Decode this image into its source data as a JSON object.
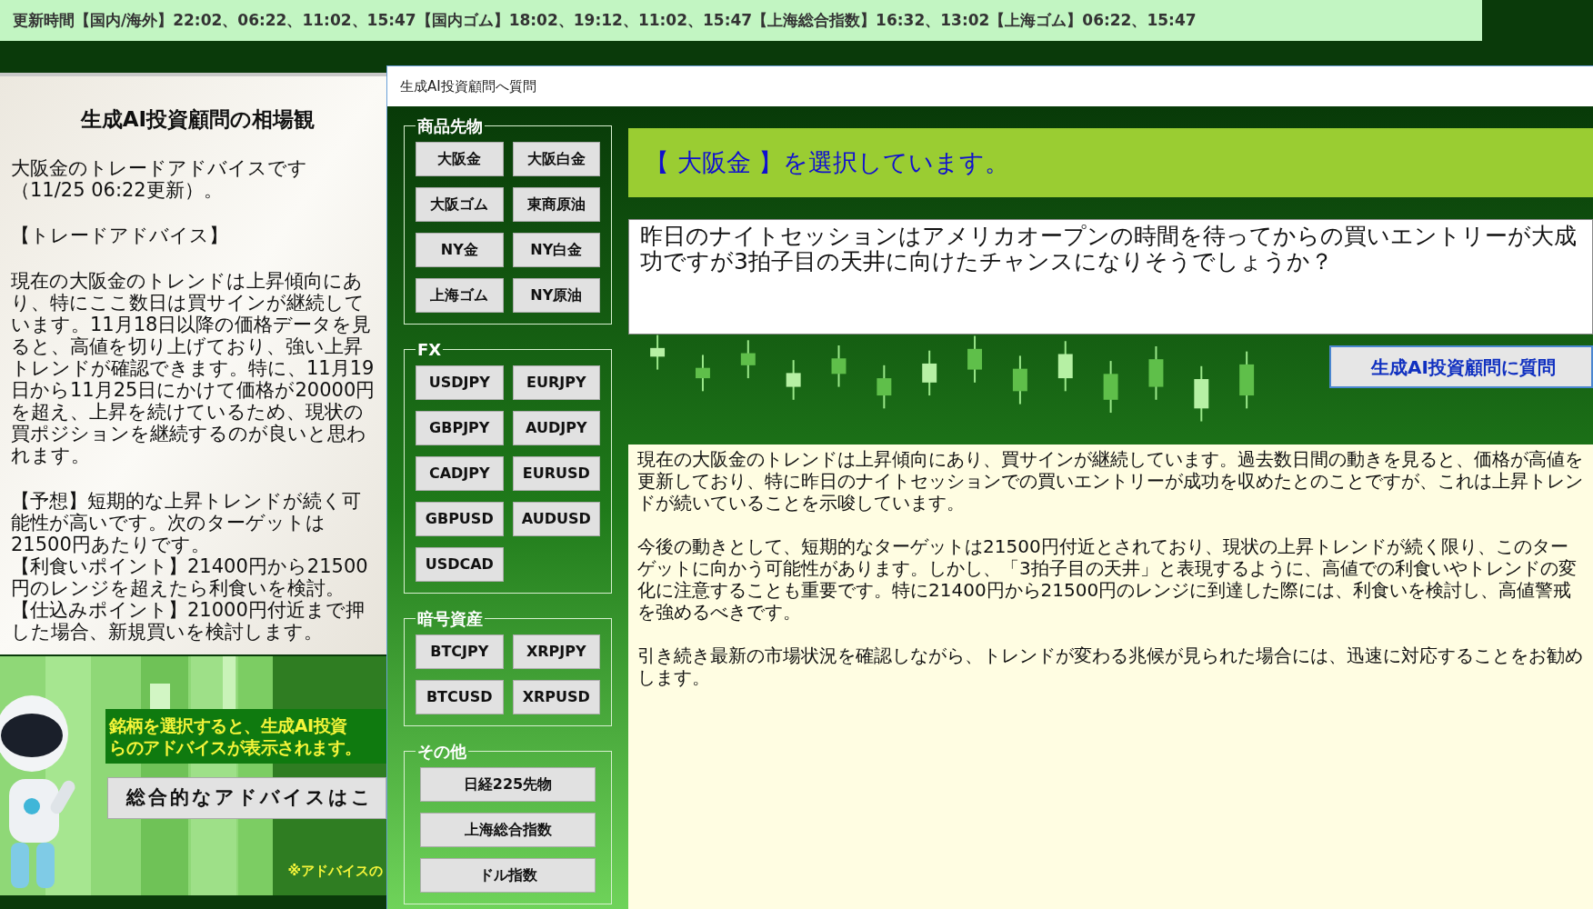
{
  "update_bar": {
    "text": "更新時間【国内/海外】22:02、06:22、11:02、15:47【国内ゴム】18:02、19:12、11:02、15:47【上海総合指数】16:32、13:02【上海ゴム】06:22、15:47"
  },
  "advice_panel": {
    "title": "生成AI投資顧問の相場観",
    "blocks": [
      [
        "大阪金のトレードアドバイスです（11/25 06:22更新）。"
      ],
      [
        "【トレードアドバイス】"
      ],
      [
        "現在の大阪金のトレンドは上昇傾向にあり、特にここ数日は買サインが継続しています。11月18日以降の価格データを見ると、高値を切り上げており、強い上昇トレンドが確認できます。特に、11月19日から11月25日にかけて価格が20000円を超え、上昇を続けているため、現状の買ポジションを継続するのが良いと思われます。"
      ],
      [
        "【予想】短期的な上昇トレンドが続く可能性が高いです。次のターゲットは21500円あたりです。",
        "【利食いポイント】21400円から21500円のレンジを超えたら利食いを検討。",
        "【仕込みポイント】21000円付近まで押した場合、新規買いを検討します。"
      ]
    ]
  },
  "banner": {
    "message_lines": [
      "銘柄を選択すると、生成AI投資",
      "らのアドバイスが表示されます。"
    ],
    "button": "総合的なアドバイスはこ",
    "note": "※アドバイスの"
  },
  "dialog": {
    "title": "生成AI投資顧問へ質問",
    "groups": [
      {
        "label": "商品先物",
        "kind": "grid",
        "buttons": [
          "大阪金",
          "大阪白金",
          "大阪ゴム",
          "東商原油",
          "NY金",
          "NY白金",
          "上海ゴム",
          "NY原油"
        ]
      },
      {
        "label": "FX",
        "kind": "grid",
        "buttons": [
          "USDJPY",
          "EURJPY",
          "GBPJPY",
          "AUDJPY",
          "CADJPY",
          "EURUSD",
          "GBPUSD",
          "AUDUSD",
          "USDCAD"
        ]
      },
      {
        "label": "暗号資産",
        "kind": "grid",
        "buttons": [
          "BTCJPY",
          "XRPJPY",
          "BTCUSD",
          "XRPUSD"
        ]
      },
      {
        "label": "その他",
        "kind": "stack",
        "buttons": [
          "日経225先物",
          "上海総合指数",
          "ドル指数"
        ]
      }
    ],
    "selection": "【 大阪金 】を選択しています。",
    "question": "昨日のナイトセッションはアメリカオープンの時間を待ってからの買いエントリーが大成功ですが3拍子目の天井に向けたチャンスになりそうでしょうか？",
    "ask_button": "生成AI投資顧問に質問",
    "answer": [
      "現在の大阪金のトレンドは上昇傾向にあり、買サインが継続しています。過去数日間の動きを見ると、価格が高値を更新しており、特に昨日のナイトセッションでの買いエントリーが成功を収めたとのことですが、これは上昇トレンドが続いていることを示唆しています。",
      "今後の動きとして、短期的なターゲットは21500円付近とされており、現状の上昇トレンドが続く限り、このターゲットに向かう可能性があります。しかし、「3拍子目の天井」と表現するように、高値での利食いやトレンドの変化に注意することも重要です。特に21400円から21500円のレンジに到達した際には、利食いを検討し、高値警戒を強めるべきです。",
      "引き続き最新の市場状況を確認しながら、トレンドが変わる兆候が見られた場合には、迅速に対応することをお勧めします。"
    ]
  }
}
